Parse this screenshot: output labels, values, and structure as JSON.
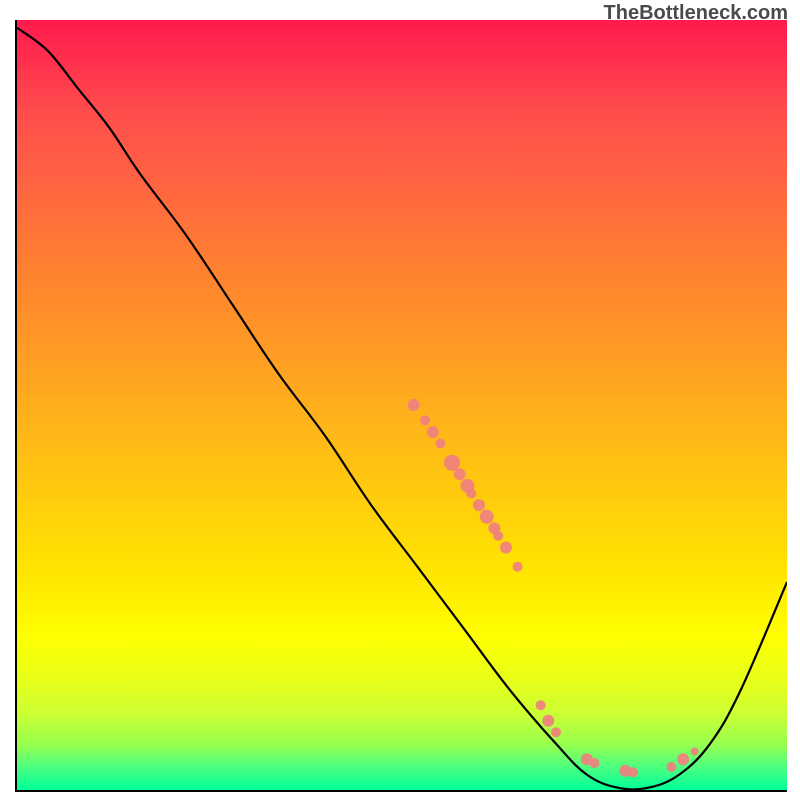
{
  "watermark": "TheBottleneck.com",
  "chart_data": {
    "type": "line",
    "title": "",
    "xlabel": "",
    "ylabel": "",
    "xlim": [
      0,
      100
    ],
    "ylim": [
      0,
      100
    ],
    "curve_points": [
      {
        "x": 0,
        "y": 99
      },
      {
        "x": 4,
        "y": 96
      },
      {
        "x": 8,
        "y": 91
      },
      {
        "x": 12,
        "y": 86
      },
      {
        "x": 16,
        "y": 80
      },
      {
        "x": 22,
        "y": 72
      },
      {
        "x": 28,
        "y": 63
      },
      {
        "x": 34,
        "y": 54
      },
      {
        "x": 40,
        "y": 46
      },
      {
        "x": 46,
        "y": 37
      },
      {
        "x": 52,
        "y": 29
      },
      {
        "x": 58,
        "y": 21
      },
      {
        "x": 64,
        "y": 13
      },
      {
        "x": 70,
        "y": 6
      },
      {
        "x": 74,
        "y": 2
      },
      {
        "x": 78,
        "y": 0.3
      },
      {
        "x": 82,
        "y": 0.3
      },
      {
        "x": 86,
        "y": 2
      },
      {
        "x": 90,
        "y": 6
      },
      {
        "x": 94,
        "y": 13
      },
      {
        "x": 100,
        "y": 27
      }
    ],
    "scatter_clusters": [
      {
        "x": 51.5,
        "y": 50,
        "r": 6
      },
      {
        "x": 53,
        "y": 48,
        "r": 5
      },
      {
        "x": 54,
        "y": 46.5,
        "r": 6
      },
      {
        "x": 55,
        "y": 45,
        "r": 5
      },
      {
        "x": 56.5,
        "y": 42.5,
        "r": 8
      },
      {
        "x": 57.5,
        "y": 41,
        "r": 6
      },
      {
        "x": 58.5,
        "y": 39.5,
        "r": 7
      },
      {
        "x": 59,
        "y": 38.5,
        "r": 5
      },
      {
        "x": 60,
        "y": 37,
        "r": 6
      },
      {
        "x": 61,
        "y": 35.5,
        "r": 7
      },
      {
        "x": 62,
        "y": 34,
        "r": 6
      },
      {
        "x": 62.5,
        "y": 33,
        "r": 5
      },
      {
        "x": 63.5,
        "y": 31.5,
        "r": 6
      },
      {
        "x": 65,
        "y": 29,
        "r": 5
      },
      {
        "x": 68,
        "y": 11,
        "r": 5
      },
      {
        "x": 69,
        "y": 9,
        "r": 6
      },
      {
        "x": 70,
        "y": 7.5,
        "r": 5
      },
      {
        "x": 74,
        "y": 4,
        "r": 6
      },
      {
        "x": 75,
        "y": 3.5,
        "r": 5
      },
      {
        "x": 79,
        "y": 2.5,
        "r": 6
      },
      {
        "x": 80,
        "y": 2.3,
        "r": 5
      },
      {
        "x": 85,
        "y": 3,
        "r": 5
      },
      {
        "x": 86.5,
        "y": 4,
        "r": 6
      },
      {
        "x": 88,
        "y": 5,
        "r": 4
      }
    ],
    "scatter_color": "#f08080"
  }
}
